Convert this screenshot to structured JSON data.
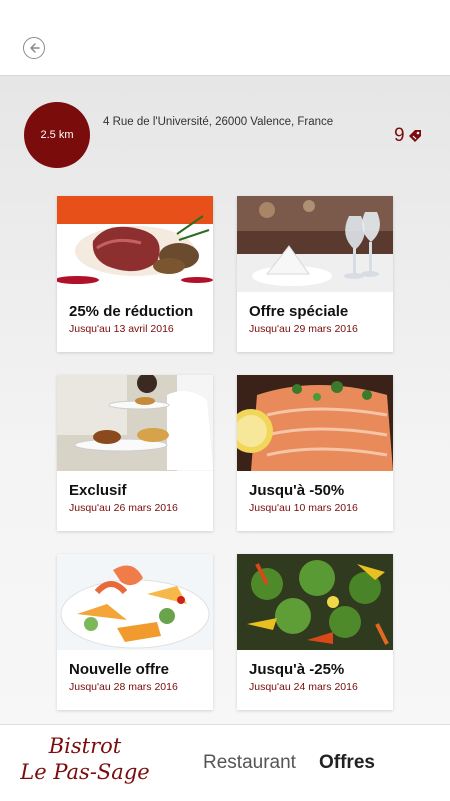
{
  "header": {
    "back_icon": "back-arrow-circle-icon"
  },
  "restaurant": {
    "distance": "2.5 km",
    "address": "4 Rue de l'Université, 26000 Valence, France",
    "offer_count": "9",
    "offer_count_icon": "tag-icon"
  },
  "offers": [
    {
      "title": "25% de réduction",
      "date": "Jusqu'au 13 avril 2016"
    },
    {
      "title": "Offre spéciale",
      "date": "Jusqu'au 29 mars 2016"
    },
    {
      "title": "Exclusif",
      "date": "Jusqu'au 26 mars 2016"
    },
    {
      "title": "Jusqu'à -50%",
      "date": "Jusqu'au 10 mars 2016"
    },
    {
      "title": "Nouvelle offre",
      "date": "Jusqu'au 28 mars 2016"
    },
    {
      "title": "Jusqu'à -25%",
      "date": "Jusqu'au 24 mars 2016"
    }
  ],
  "footer": {
    "logo_line1": "Bistrot",
    "logo_line2": "Le Pas-Sage",
    "nav": [
      {
        "label": "Restaurant",
        "active": false
      },
      {
        "label": "Offres",
        "active": true
      }
    ]
  },
  "colors": {
    "accent": "#7a0c0c",
    "text": "#111111",
    "nav_inactive": "#555555",
    "nav_active": "#222222"
  }
}
